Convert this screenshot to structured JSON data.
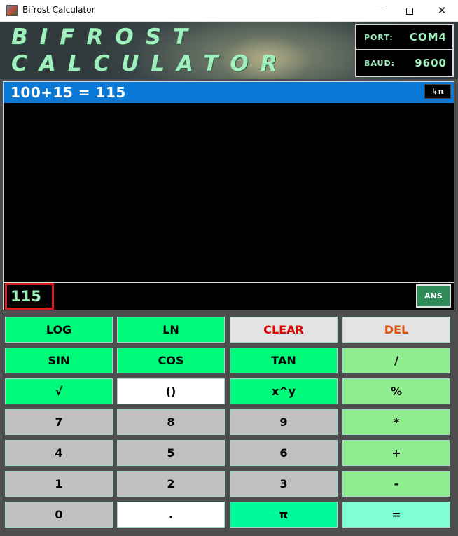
{
  "window": {
    "title": "Bifrost Calculator",
    "minimize_label": "",
    "close_glyph": "✕"
  },
  "header": {
    "logo_line1": "BIFROST",
    "logo_line2": "CALCULATOR",
    "port_label": "PORT:",
    "port_value": "COM4",
    "baud_label": "BAUD:",
    "baud_value": "9600"
  },
  "display": {
    "expression": "100+15 = 115",
    "mode_label": "↳π",
    "result": "115",
    "ans_label": "ANS"
  },
  "keypad": {
    "rows": [
      [
        {
          "label": "LOG",
          "style": "green",
          "color": "#000000"
        },
        {
          "label": "LN",
          "style": "green",
          "color": "#000000"
        },
        {
          "label": "CLEAR",
          "style": "lightgray",
          "color": "#e00000"
        },
        {
          "label": "DEL",
          "style": "lightgray",
          "color": "#e05010"
        }
      ],
      [
        {
          "label": "SIN",
          "style": "green",
          "color": "#000000"
        },
        {
          "label": "COS",
          "style": "green",
          "color": "#000000"
        },
        {
          "label": "TAN",
          "style": "green",
          "color": "#000000"
        },
        {
          "label": "/",
          "style": "lightgreen",
          "color": "#000000"
        }
      ],
      [
        {
          "label": "√",
          "style": "green",
          "color": "#000000"
        },
        {
          "label": "()",
          "style": "white",
          "color": "#000000"
        },
        {
          "label": "x^y",
          "style": "green",
          "color": "#000000"
        },
        {
          "label": "%",
          "style": "lightgreen",
          "color": "#000000"
        }
      ],
      [
        {
          "label": "7",
          "style": "gray",
          "color": "#000000"
        },
        {
          "label": "8",
          "style": "gray",
          "color": "#000000"
        },
        {
          "label": "9",
          "style": "gray",
          "color": "#000000"
        },
        {
          "label": "*",
          "style": "lightgreen",
          "color": "#000000"
        }
      ],
      [
        {
          "label": "4",
          "style": "gray",
          "color": "#000000"
        },
        {
          "label": "5",
          "style": "gray",
          "color": "#000000"
        },
        {
          "label": "6",
          "style": "gray",
          "color": "#000000"
        },
        {
          "label": "+",
          "style": "lightgreen",
          "color": "#000000"
        }
      ],
      [
        {
          "label": "1",
          "style": "gray",
          "color": "#000000"
        },
        {
          "label": "2",
          "style": "gray",
          "color": "#000000"
        },
        {
          "label": "3",
          "style": "gray",
          "color": "#000000"
        },
        {
          "label": "-",
          "style": "lightgreen",
          "color": "#000000"
        }
      ],
      [
        {
          "label": "0",
          "style": "gray",
          "color": "#000000"
        },
        {
          "label": ".",
          "style": "white",
          "color": "#000000"
        },
        {
          "label": "π",
          "style": "teal",
          "color": "#000000"
        },
        {
          "label": "=",
          "style": "aqua",
          "color": "#000000"
        }
      ]
    ]
  },
  "colors": {
    "accent_blue": "#0a78d7",
    "result_highlight": "#e02020",
    "text_green": "#9ff0bd"
  }
}
